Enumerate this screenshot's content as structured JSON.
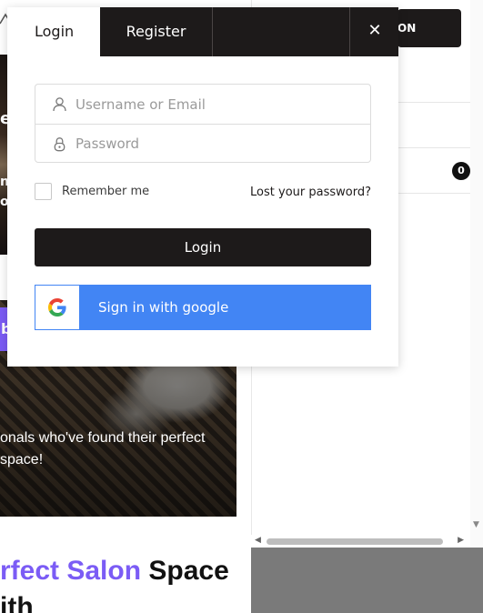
{
  "background": {
    "top_button_label": "ON",
    "cart_badge": "0",
    "caption": "onals who've found their perfect space!",
    "headline_accent": "rfect Salon",
    "headline_plain": "Space",
    "headline_line2": "ith",
    "crop_text_1": "e",
    "crop_text_2": "n",
    "crop_text_3": "o",
    "purple_button_fragment": "b",
    "colors": {
      "accent": "#7b5cf5",
      "dark": "#1d1a1a"
    }
  },
  "modal": {
    "tabs": [
      {
        "label": "Login",
        "active": true
      },
      {
        "label": "Register",
        "active": false
      }
    ],
    "close_icon": "close-icon",
    "username_placeholder": "Username or Email",
    "password_placeholder": "Password",
    "remember_label": "Remember me",
    "lost_password_label": "Lost your password?",
    "login_button_label": "Login",
    "google_button_label": "Sign in with google",
    "colors": {
      "google_blue": "#4285f4",
      "tab_dark": "#1d1a1a"
    }
  }
}
